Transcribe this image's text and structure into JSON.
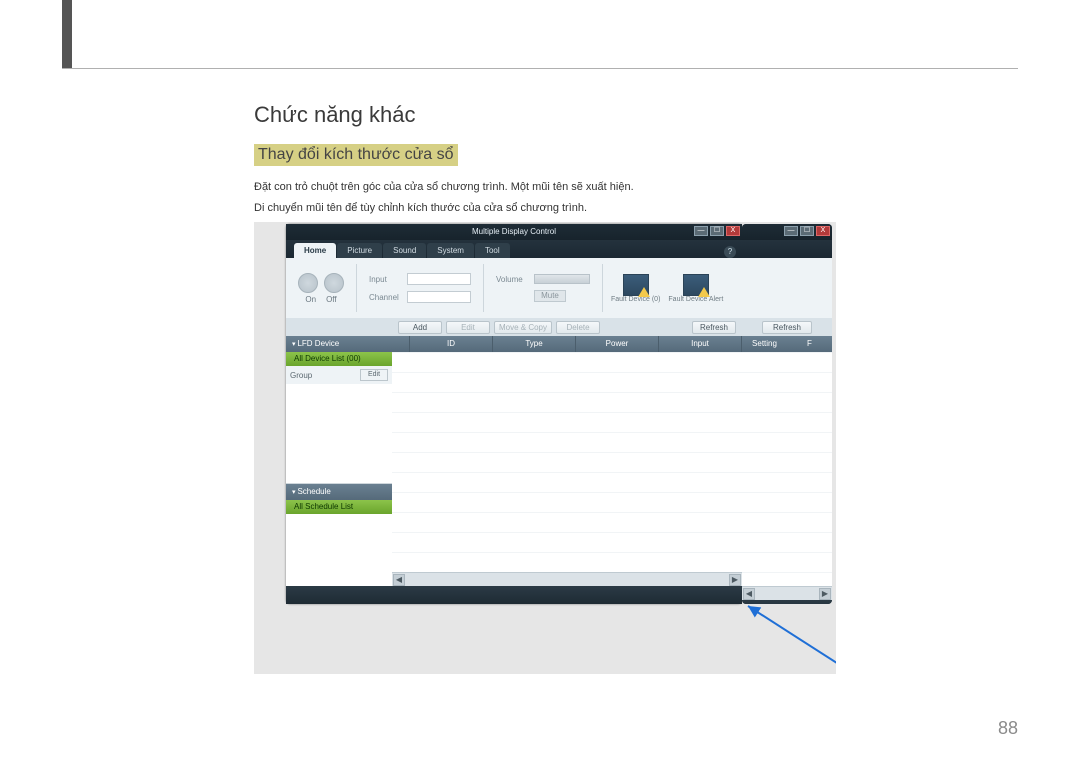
{
  "doc": {
    "heading": "Chức năng khác",
    "subheading": "Thay đổi kích thước cửa sổ",
    "p1": "Đặt con trỏ chuột trên góc của cửa sổ chương trình. Một mũi tên sẽ xuất hiện.",
    "p2": "Di chuyển mũi tên để tùy chỉnh kích thước của cửa sổ chương trình.",
    "page_number": "88"
  },
  "app": {
    "title": "Multiple Display Control",
    "win_min": "—",
    "win_max": "☐",
    "win_close": "X",
    "help": "?",
    "tabs": {
      "home": "Home",
      "picture": "Picture",
      "sound": "Sound",
      "system": "System",
      "tool": "Tool"
    },
    "ribbon": {
      "on": "On",
      "off": "Off",
      "input": "Input",
      "channel": "Channel",
      "volume": "Volume",
      "mute": "Mute",
      "fault_device0": "Fault Device (0)",
      "fault_alert": "Fault Device Alert"
    },
    "toolbar": {
      "add": "Add",
      "edit": "Edit",
      "move_copy": "Move & Copy",
      "delete": "Delete",
      "refresh": "Refresh"
    },
    "side": {
      "lfd": "LFD Device",
      "all_devices": "All Device List (00)",
      "group": "Group",
      "edit_btn": "Edit",
      "schedule": "Schedule",
      "all_schedule": "All Schedule List"
    },
    "columns": {
      "check": "",
      "id": "ID",
      "type": "Type",
      "power": "Power",
      "input": "Input",
      "setting": "Setting"
    },
    "win2": {
      "refresh": "Refresh",
      "setting": "Setting",
      "f": "F"
    }
  }
}
